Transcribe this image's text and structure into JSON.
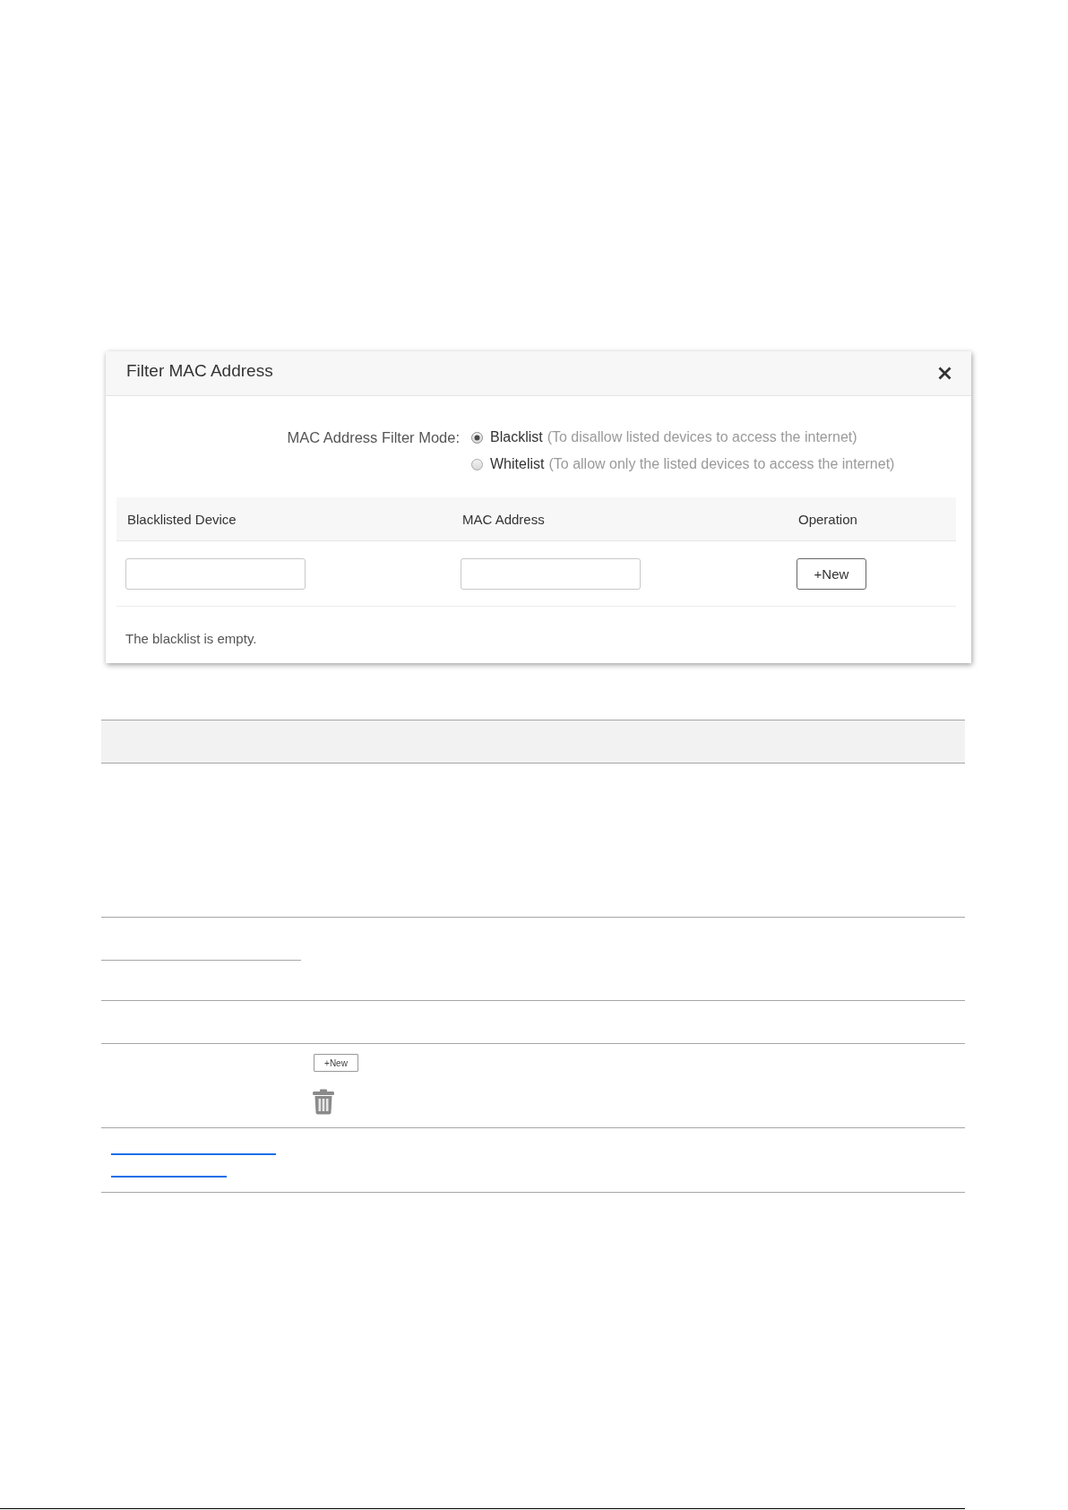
{
  "dialog": {
    "title": "Filter MAC Address",
    "mode": {
      "label": "MAC Address Filter Mode:",
      "options": [
        {
          "label": "Blacklist",
          "hint": "(To disallow listed devices to access the internet)",
          "selected": true
        },
        {
          "label": "Whitelist",
          "hint": "(To allow only the listed devices to access the internet)",
          "selected": false
        }
      ]
    },
    "table": {
      "columns": [
        "Blacklisted Device",
        "MAC Address",
        "Operation"
      ],
      "new_button": "+New",
      "empty_message": "The blacklist is empty."
    }
  },
  "doc_table": {
    "new_button": "+New"
  }
}
